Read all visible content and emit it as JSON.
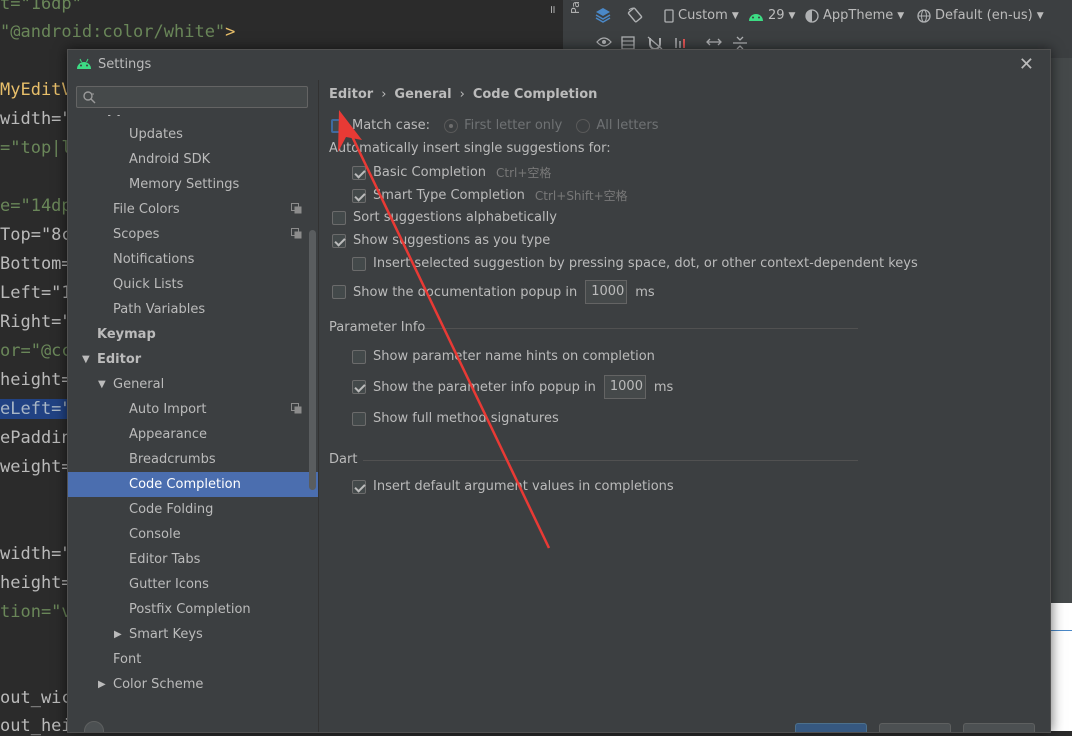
{
  "editor": {
    "lines": [
      [
        {
          "t": "t=\"16dp\"",
          "c": "tok-str"
        }
      ],
      [
        {
          "t": "\"@android:color/white\"",
          "c": "tok-str"
        },
        {
          "t": ">",
          "c": "tok-tag"
        }
      ],
      [
        {
          "t": "",
          "c": ""
        }
      ],
      [
        {
          "t": "MyEditV",
          "c": "tok-tag"
        }
      ],
      [
        {
          "t": "width=\"",
          "c": "tok-attr"
        }
      ],
      [
        {
          "t": "=\"top|l",
          "c": "tok-str"
        }
      ],
      [
        {
          "t": "",
          "c": ""
        }
      ],
      [
        {
          "t": "e=\"14dp",
          "c": "tok-str"
        }
      ],
      [
        {
          "t": "Top=\"8c",
          "c": "tok-attr"
        }
      ],
      [
        {
          "t": "Bottom=",
          "c": "tok-attr"
        }
      ],
      [
        {
          "t": "Left=\"1",
          "c": "tok-attr"
        }
      ],
      [
        {
          "t": "Right=\"",
          "c": "tok-attr"
        }
      ],
      [
        {
          "t": "or=\"@cc",
          "c": "tok-str"
        }
      ],
      [
        {
          "t": "height=",
          "c": "tok-attr"
        }
      ],
      [
        {
          "t": "eLeft=\"",
          "c": "tok-hl"
        }
      ],
      [
        {
          "t": "ePaddin",
          "c": "tok-attr"
        }
      ],
      [
        {
          "t": "weight=",
          "c": "tok-attr"
        }
      ],
      [
        {
          "t": "",
          "c": ""
        }
      ],
      [
        {
          "t": "",
          "c": ""
        }
      ],
      [
        {
          "t": "width=\"",
          "c": "tok-attr"
        }
      ],
      [
        {
          "t": "height=",
          "c": "tok-attr"
        }
      ],
      [
        {
          "t": "tion=\"v",
          "c": "tok-str"
        }
      ],
      [
        {
          "t": "",
          "c": ""
        }
      ],
      [
        {
          "t": "",
          "c": ""
        }
      ],
      [
        {
          "t": "out_wic",
          "c": "tok-attr"
        }
      ],
      [
        {
          "t": "out_hei",
          "c": "tok-attr"
        }
      ]
    ],
    "pause_glyph": "॥"
  },
  "design_toolbar": {
    "palette_label": "Palette",
    "device_label": "Custom",
    "api_label": "29",
    "theme_label": "AppTheme",
    "locale_label": "Default (en-us)"
  },
  "dialog": {
    "title": "Settings",
    "close_glyph": "✕",
    "search_placeholder": "",
    "tree": [
      {
        "label": "Appearance & Behavior",
        "bold": true
      },
      {
        "label": "Updates"
      },
      {
        "label": "Android SDK"
      },
      {
        "label": "Memory Settings"
      },
      {
        "label": "File Colors",
        "badge": true
      },
      {
        "label": "Scopes",
        "badge": true
      },
      {
        "label": "Notifications"
      },
      {
        "label": "Quick Lists"
      },
      {
        "label": "Path Variables"
      },
      {
        "label": "Keymap",
        "bold": true
      },
      {
        "label": "Editor",
        "bold": true,
        "arrow": "▼"
      },
      {
        "label": "General",
        "arrow": "▼"
      },
      {
        "label": "Auto Import",
        "badge": true
      },
      {
        "label": "Appearance"
      },
      {
        "label": "Breadcrumbs"
      },
      {
        "label": "Code Completion",
        "selected": true
      },
      {
        "label": "Code Folding"
      },
      {
        "label": "Console"
      },
      {
        "label": "Editor Tabs"
      },
      {
        "label": "Gutter Icons"
      },
      {
        "label": "Postfix Completion"
      },
      {
        "label": "Smart Keys",
        "arrow": "▶"
      },
      {
        "label": "Font"
      },
      {
        "label": "Color Scheme",
        "arrow": "▶"
      }
    ],
    "breadcrumb": {
      "part1": "Editor",
      "part2": "General",
      "part3": "Code Completion",
      "separator": "›"
    },
    "options": {
      "match_case": "Match case:",
      "first_letter_only": "First letter only",
      "all_letters": "All letters",
      "auto_insert_heading": "Automatically insert single suggestions for:",
      "basic_completion": "Basic Completion",
      "basic_shortcut": "Ctrl+空格",
      "smart_type_completion": "Smart Type Completion",
      "smart_shortcut": "Ctrl+Shift+空格",
      "sort_alpha": "Sort suggestions alphabetically",
      "show_as_you_type": "Show suggestions as you type",
      "insert_selected": "Insert selected suggestion by pressing space, dot, or other context-dependent keys",
      "show_doc_popup": "Show the documentation popup in",
      "doc_popup_ms": "1000",
      "ms_unit": "ms"
    },
    "parameter_info": {
      "title": "Parameter Info",
      "name_hints": "Show parameter name hints on completion",
      "info_popup": "Show the parameter info popup in",
      "info_popup_ms": "1000",
      "ms_unit": "ms",
      "full_signatures": "Show full method signatures"
    },
    "dart": {
      "title": "Dart",
      "insert_default_args": "Insert default argument values in completions"
    }
  },
  "colors": {
    "annotation_arrow": "#e83a35",
    "selection": "#4b6eaf",
    "android_green": "#3ddc84"
  }
}
